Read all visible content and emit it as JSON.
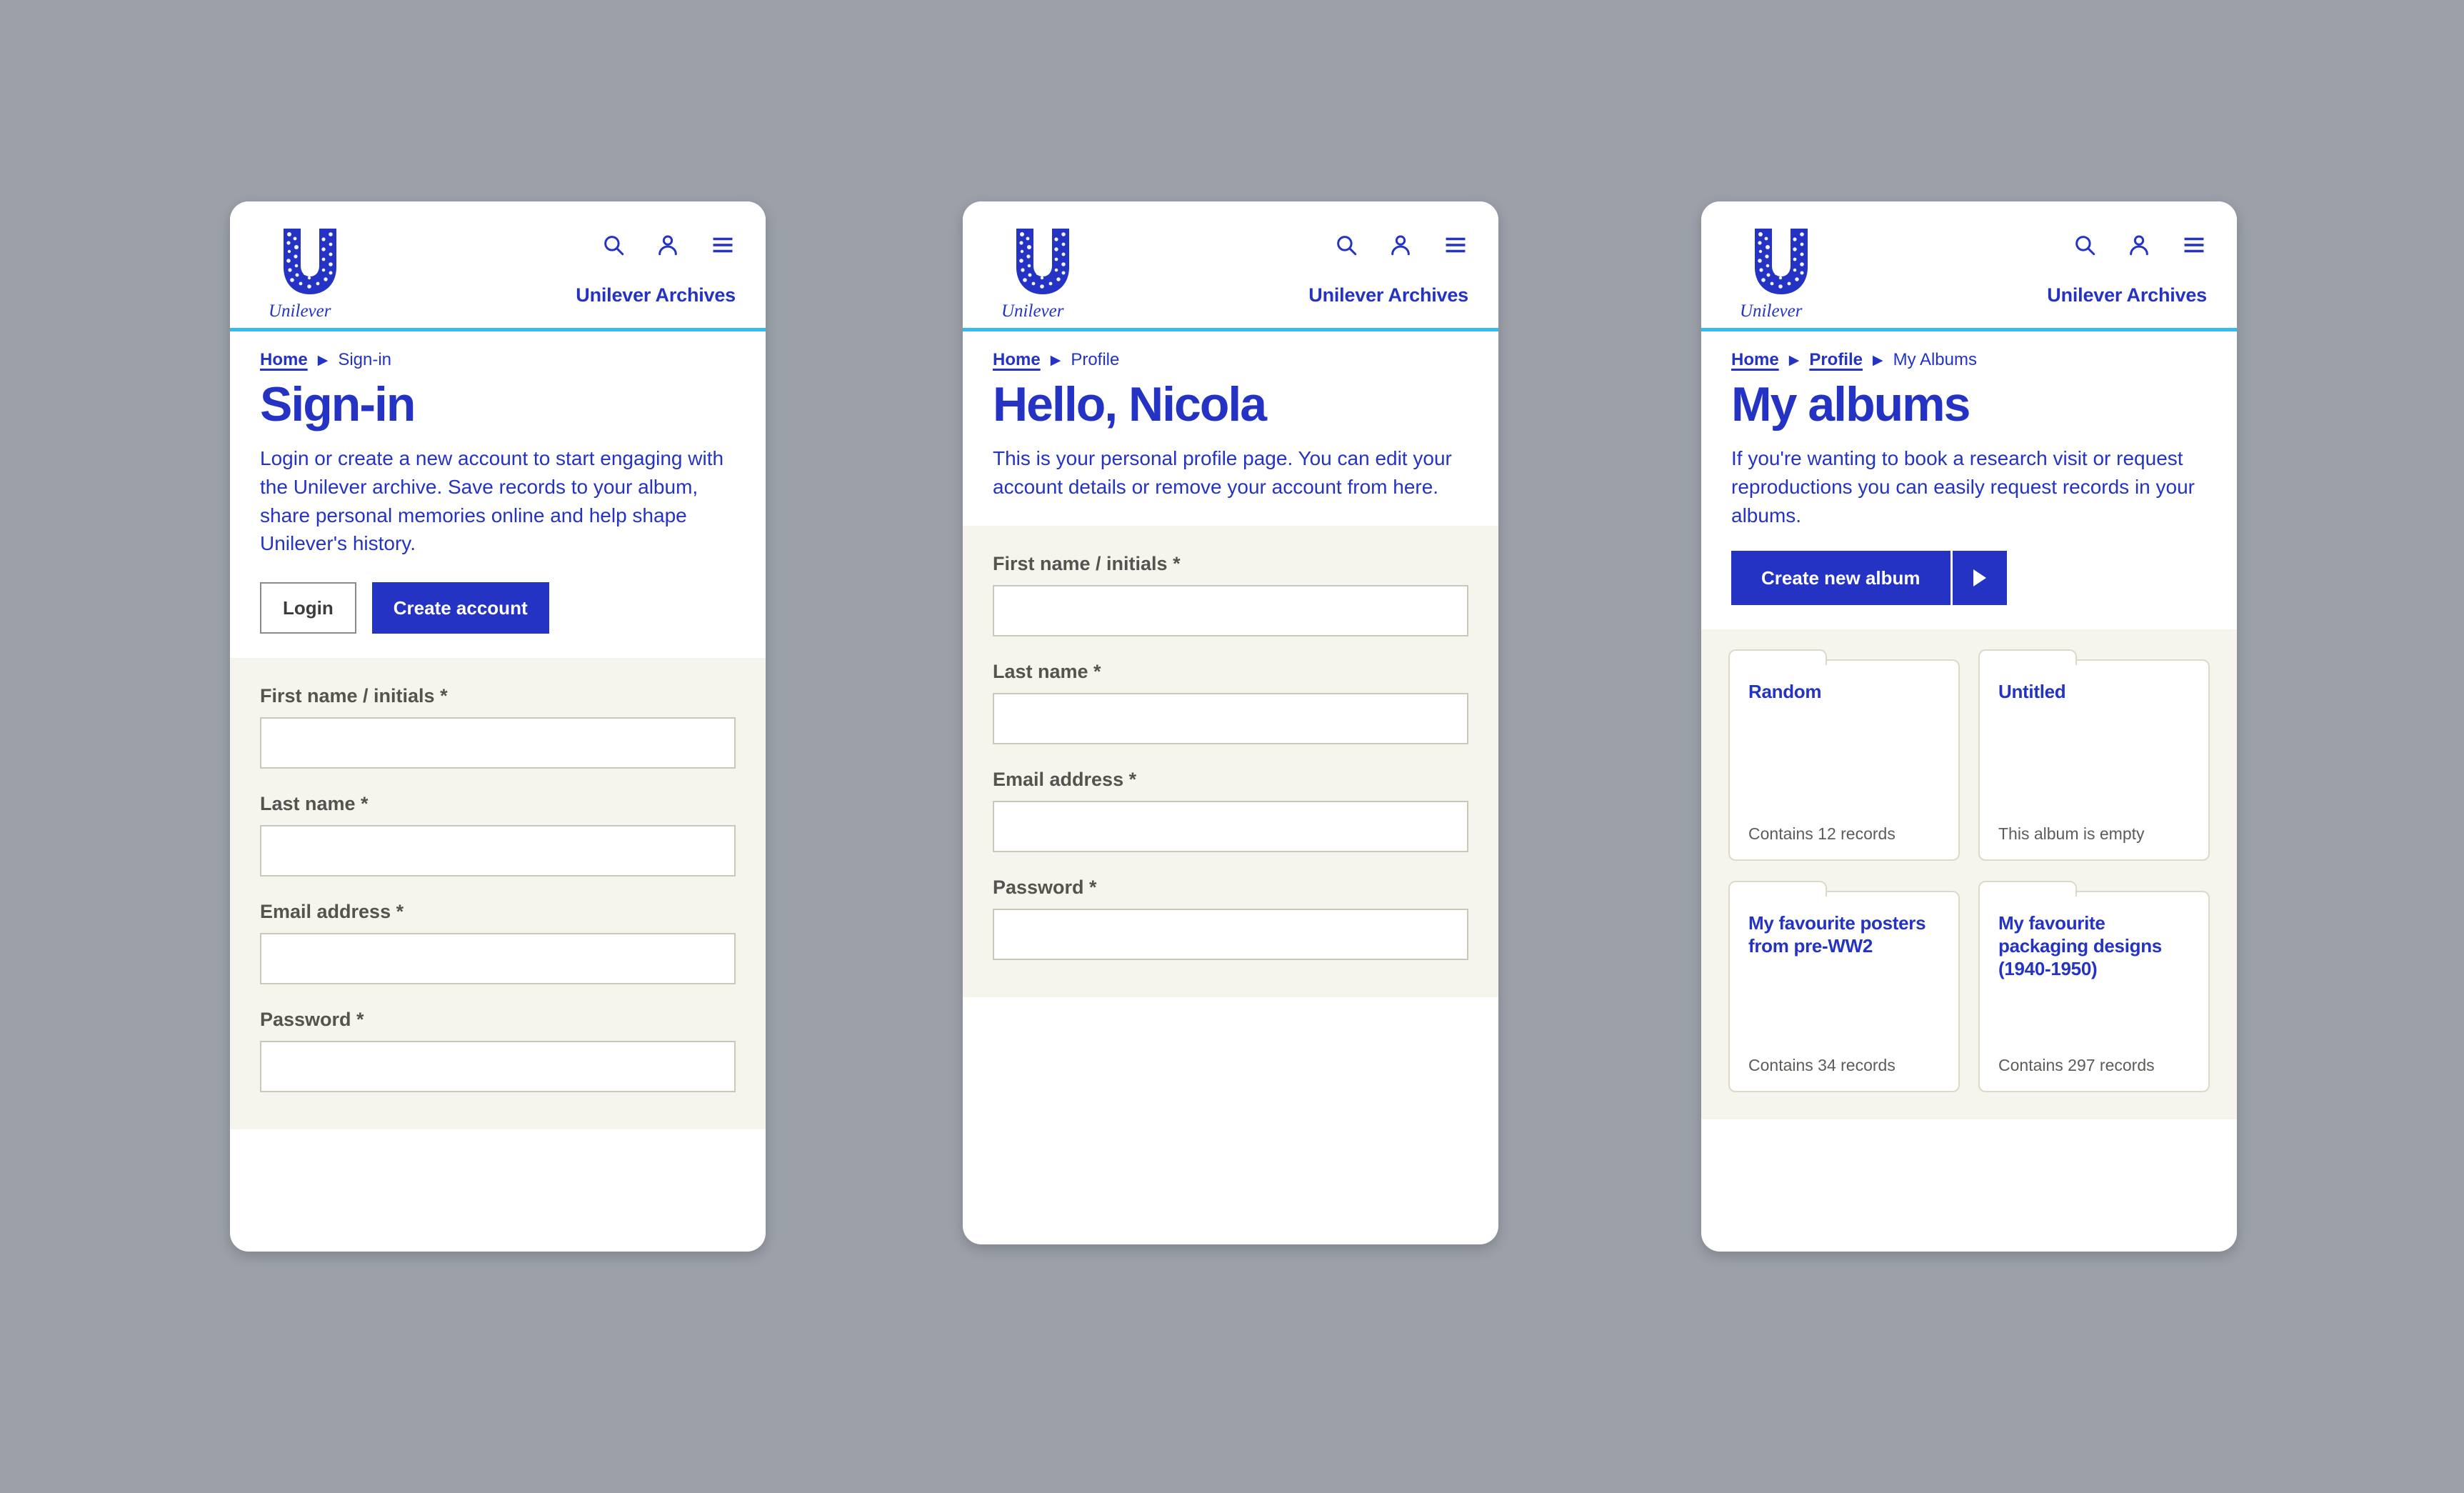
{
  "colors": {
    "page_background": "#9ba0a9",
    "brand_blue": "#2433c4",
    "accent_cyan": "#35b9f2",
    "cream": "#f5f5ed",
    "label_gray": "#55534f"
  },
  "brand": {
    "logo_icon": "unilever-u-logo",
    "wordmark": "Unilever",
    "site_label": "Unilever Archives"
  },
  "header_icons": [
    {
      "name": "search-icon",
      "label": "Search"
    },
    {
      "name": "account-icon",
      "label": "Account"
    },
    {
      "name": "menu-icon",
      "label": "Menu"
    }
  ],
  "panels": [
    {
      "id": "signin",
      "breadcrumb": [
        {
          "label": "Home",
          "is_link": true
        },
        {
          "label": "Sign-in",
          "is_link": false
        }
      ],
      "title": "Sign-in",
      "intro": "Login or create a new account to start engaging with the Unilever archive. Save records to your album, share personal memories online and help shape Unilever's history.",
      "buttons": {
        "secondary_label": "Login",
        "primary_label": "Create account"
      },
      "fields": [
        {
          "label": "First name / initials *",
          "value": "",
          "placeholder": "",
          "type": "text"
        },
        {
          "label": "Last name *",
          "value": "",
          "placeholder": "",
          "type": "text"
        },
        {
          "label": "Email address *",
          "value": "",
          "placeholder": "",
          "type": "email"
        },
        {
          "label": "Password *",
          "value": "",
          "placeholder": "",
          "type": "password"
        }
      ]
    },
    {
      "id": "profile",
      "breadcrumb": [
        {
          "label": "Home",
          "is_link": true
        },
        {
          "label": "Profile",
          "is_link": false
        }
      ],
      "title": "Hello, Nicola",
      "intro": "This is your personal profile page. You can edit your account details or remove your account from here.",
      "fields": [
        {
          "label": "First name / initials *",
          "value": "",
          "placeholder": "",
          "type": "text"
        },
        {
          "label": "Last name *",
          "value": "",
          "placeholder": "",
          "type": "text"
        },
        {
          "label": "Email address *",
          "value": "",
          "placeholder": "",
          "type": "email"
        },
        {
          "label": "Password *",
          "value": "",
          "placeholder": "",
          "type": "password"
        }
      ]
    },
    {
      "id": "albums",
      "breadcrumb": [
        {
          "label": "Home",
          "is_link": true
        },
        {
          "label": "Profile",
          "is_link": true
        },
        {
          "label": "My Albums",
          "is_link": false
        }
      ],
      "title": "My albums",
      "intro": "If you're wanting to book a research visit or request reproductions you can easily request records in your albums.",
      "create_button": {
        "label": "Create new album",
        "arrow_icon": "triangle-right-icon"
      },
      "albums": [
        {
          "name": "Random",
          "count_text": "Contains 12 records"
        },
        {
          "name": "Untitled",
          "count_text": "This album is empty"
        },
        {
          "name": "My favourite posters from pre-WW2",
          "count_text": "Contains 34 records"
        },
        {
          "name": "My favourite packaging designs (1940-1950)",
          "count_text": "Contains 297 records"
        }
      ]
    }
  ]
}
